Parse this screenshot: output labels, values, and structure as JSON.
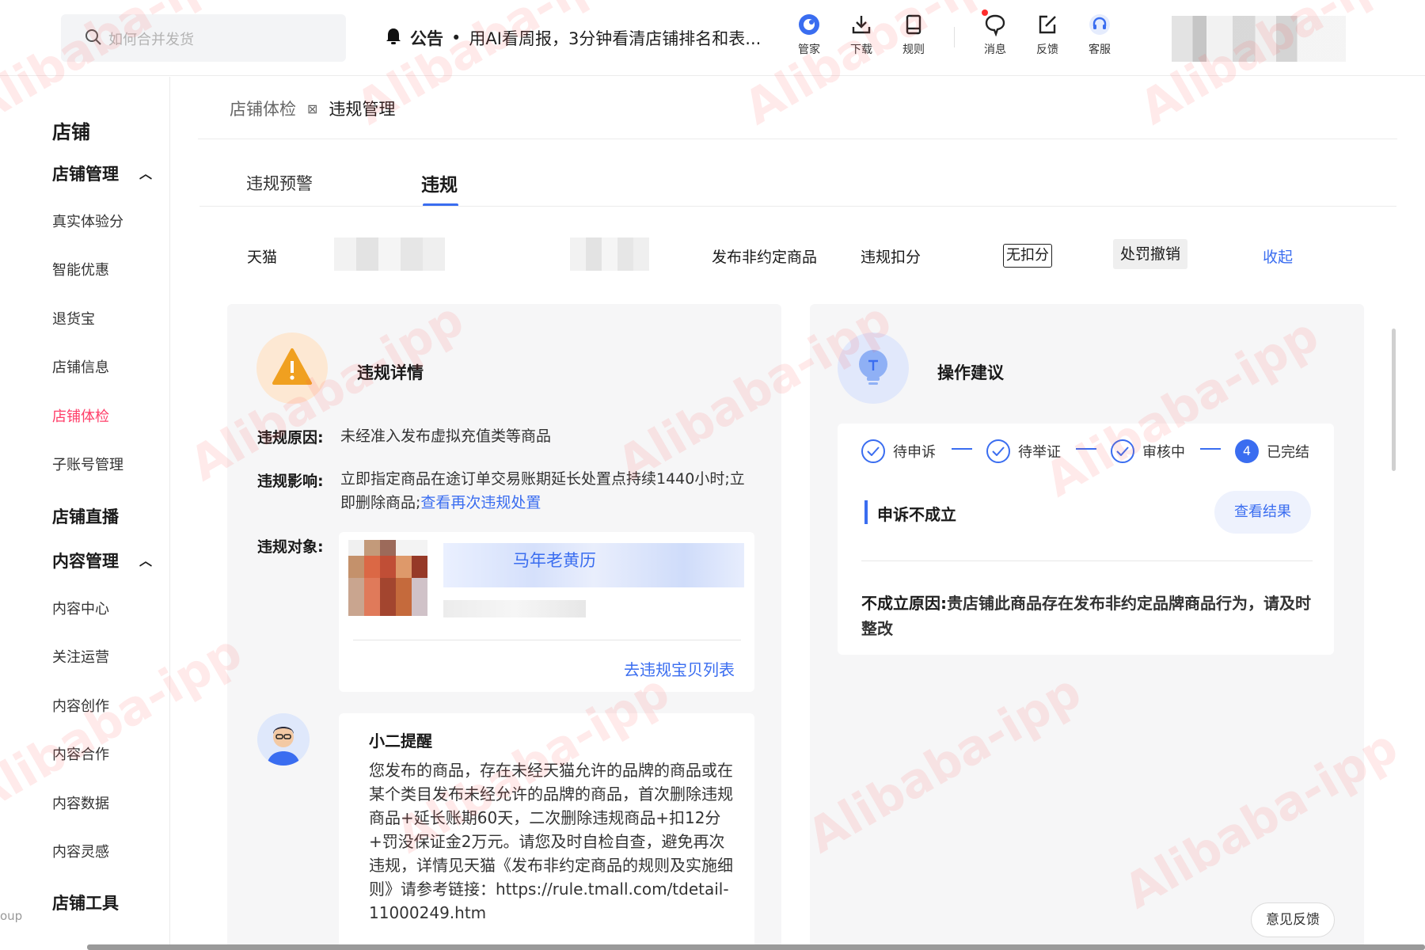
{
  "colors": {
    "accent": "#3a6df0",
    "active_nav": "#ff3d68",
    "warning": "#f0a020"
  },
  "header": {
    "search_placeholder": "如何合并发货",
    "notice_label": "公告",
    "notice_text": "用AI看周报，3分钟看清店铺排名和表...",
    "icons": [
      {
        "label": "管家",
        "icon": "assistant-icon"
      },
      {
        "label": "下载",
        "icon": "download-icon"
      },
      {
        "label": "规则",
        "icon": "book-icon"
      },
      {
        "label": "消息",
        "icon": "chat-icon"
      },
      {
        "label": "反馈",
        "icon": "edit-icon"
      },
      {
        "label": "客服",
        "icon": "headset-icon"
      }
    ]
  },
  "sidebar": {
    "group_shop": "店铺",
    "sub_shop_manage": "店铺管理",
    "shop_items": [
      "真实体验分",
      "智能优惠",
      "退货宝",
      "店铺信息",
      "店铺体检",
      "子账号管理"
    ],
    "group_live": "店铺直播",
    "sub_content_manage": "内容管理",
    "content_items": [
      "内容中心",
      "关注运营",
      "内容创作",
      "内容合作",
      "内容数据",
      "内容灵感"
    ],
    "group_tools": "店铺工具",
    "cut_text": "oup"
  },
  "breadcrumb": {
    "parent": "店铺体检",
    "current": "违规管理"
  },
  "tabs": {
    "warning": "违规预警",
    "violation": "违规"
  },
  "info_row": {
    "platform": "天猫",
    "type": "发布非约定商品",
    "deduct_label": "违规扣分",
    "deduct_value": "无扣分",
    "status": "处罚撤销",
    "collapse": "收起"
  },
  "detail": {
    "title": "违规详情",
    "reason_label": "违规原因:",
    "reason_value": "未经准入发布虚拟充值类等商品",
    "impact_label": "违规影响:",
    "impact_value": "立即指定商品在途订单交易账期延长处置点持续1440小时;立即删除商品;",
    "impact_link": "查看再次违规处置",
    "object_label": "违规对象:",
    "object_title": "马年老黄历",
    "object_link": "去违规宝贝列表"
  },
  "reminder": {
    "title": "小二提醒",
    "text": "您发布的商品，存在未经天猫允许的品牌的商品或在某个类目发布未经允许的品牌的商品，首次删除违规商品+延长账期60天，二次删除违规商品+扣12分+罚没保证金2万元。请您及时自检自查，避免再次违规，详情见天猫《发布非约定商品的规则及实施细则》请参考链接：https://rule.tmall.com/tdetail-11000249.htm"
  },
  "advice": {
    "title": "操作建议",
    "steps": [
      "待申诉",
      "待举证",
      "审核中",
      "已完结"
    ],
    "current_step_number": "4",
    "result_title": "申诉不成立",
    "result_button": "查看结果",
    "reason_label": "不成立原因:",
    "reason_text": "贵店铺此商品存在发布非约定品牌商品行为，请及时整改"
  },
  "feedback_button": "意见反馈",
  "watermark": "Alibaba-ipp"
}
